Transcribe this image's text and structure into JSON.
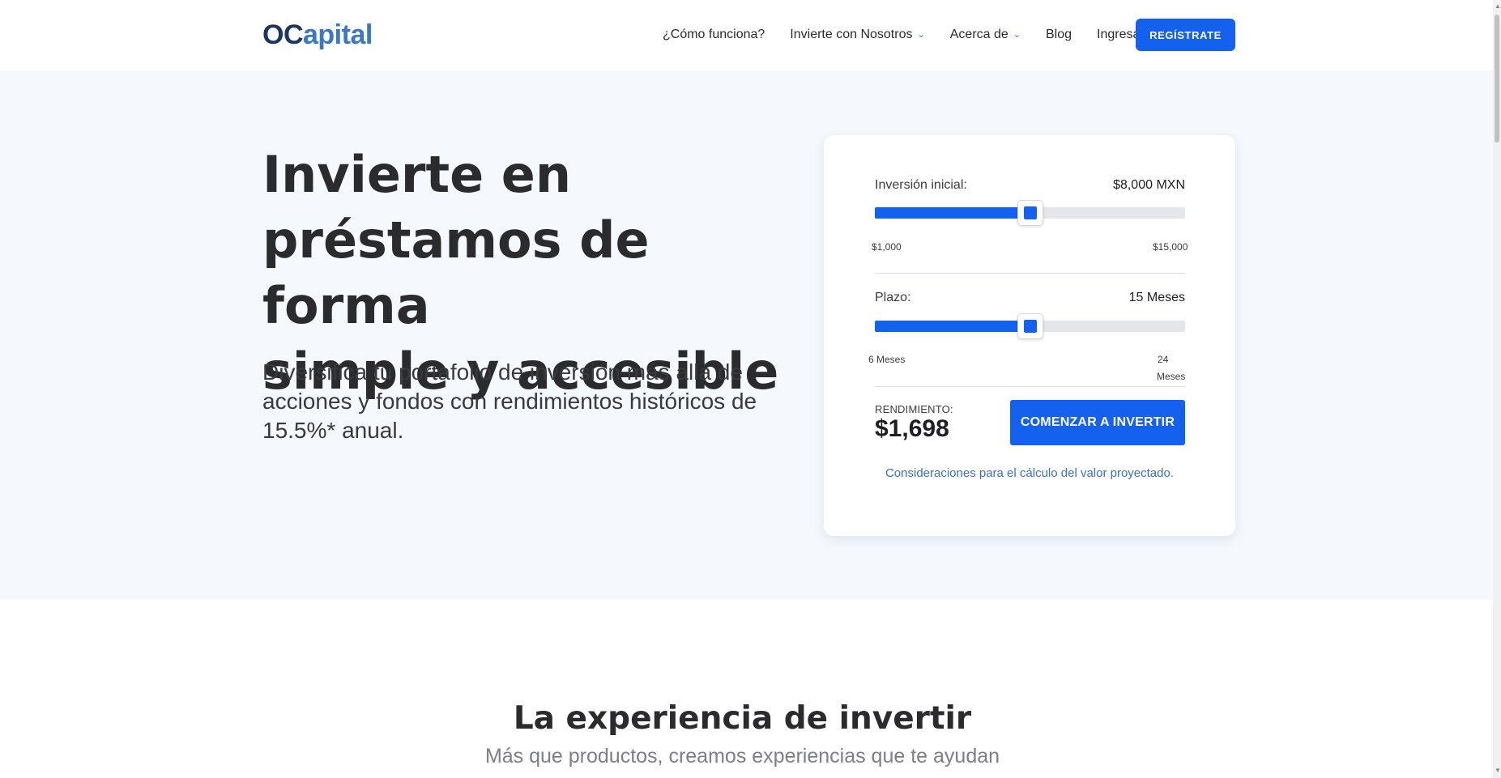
{
  "nav": {
    "logo_mark": "OC",
    "logo_word": "apital",
    "links": [
      {
        "label": "¿Cómo funciona?",
        "has_dropdown": false
      },
      {
        "label": "Invierte con Nosotros",
        "has_dropdown": true
      },
      {
        "label": "Acerca de",
        "has_dropdown": true
      },
      {
        "label": "Blog",
        "has_dropdown": false
      },
      {
        "label": "Ingresar",
        "has_dropdown": false
      }
    ],
    "register_label": "REGÍSTRATE",
    "dropdown_icon": "chevron-down-icon"
  },
  "hero": {
    "title_line1": "Invierte en",
    "title_line2": "préstamos de forma",
    "title_line3": "simple y accesible",
    "subtitle": "Diversifica tu portafolio de inversión más allá de acciones y fondos con rendimientos históricos de 15.5%* anual."
  },
  "calculator": {
    "investment": {
      "label": "Inversión inicial:",
      "value": "$8,000 MXN",
      "min_label": "$1,000",
      "max_label": "$15,000",
      "min": 1000,
      "max": 15000,
      "current": 8000
    },
    "term": {
      "label": "Plazo:",
      "value": "15 Meses",
      "min_label": "6 Meses",
      "max_label_line1": "24",
      "max_label_line2": "Meses",
      "min": 6,
      "max": 24,
      "current": 15
    },
    "return_label": "RENDIMIENTO:",
    "return_value": "$1,698",
    "cta_label": "COMENZAR A INVERTIR",
    "considerations_link": "Consideraciones para el cálculo del valor proyectado."
  },
  "section2": {
    "title": "La experiencia de invertir",
    "subtitle": "Más que productos, creamos experiencias que te ayudan"
  },
  "colors": {
    "primary": "#1461f0",
    "hero_bg": "#f5f8fd",
    "logo_dark": "#1e3561",
    "logo_light": "#3a78c4",
    "link": "#3c6fd1"
  }
}
